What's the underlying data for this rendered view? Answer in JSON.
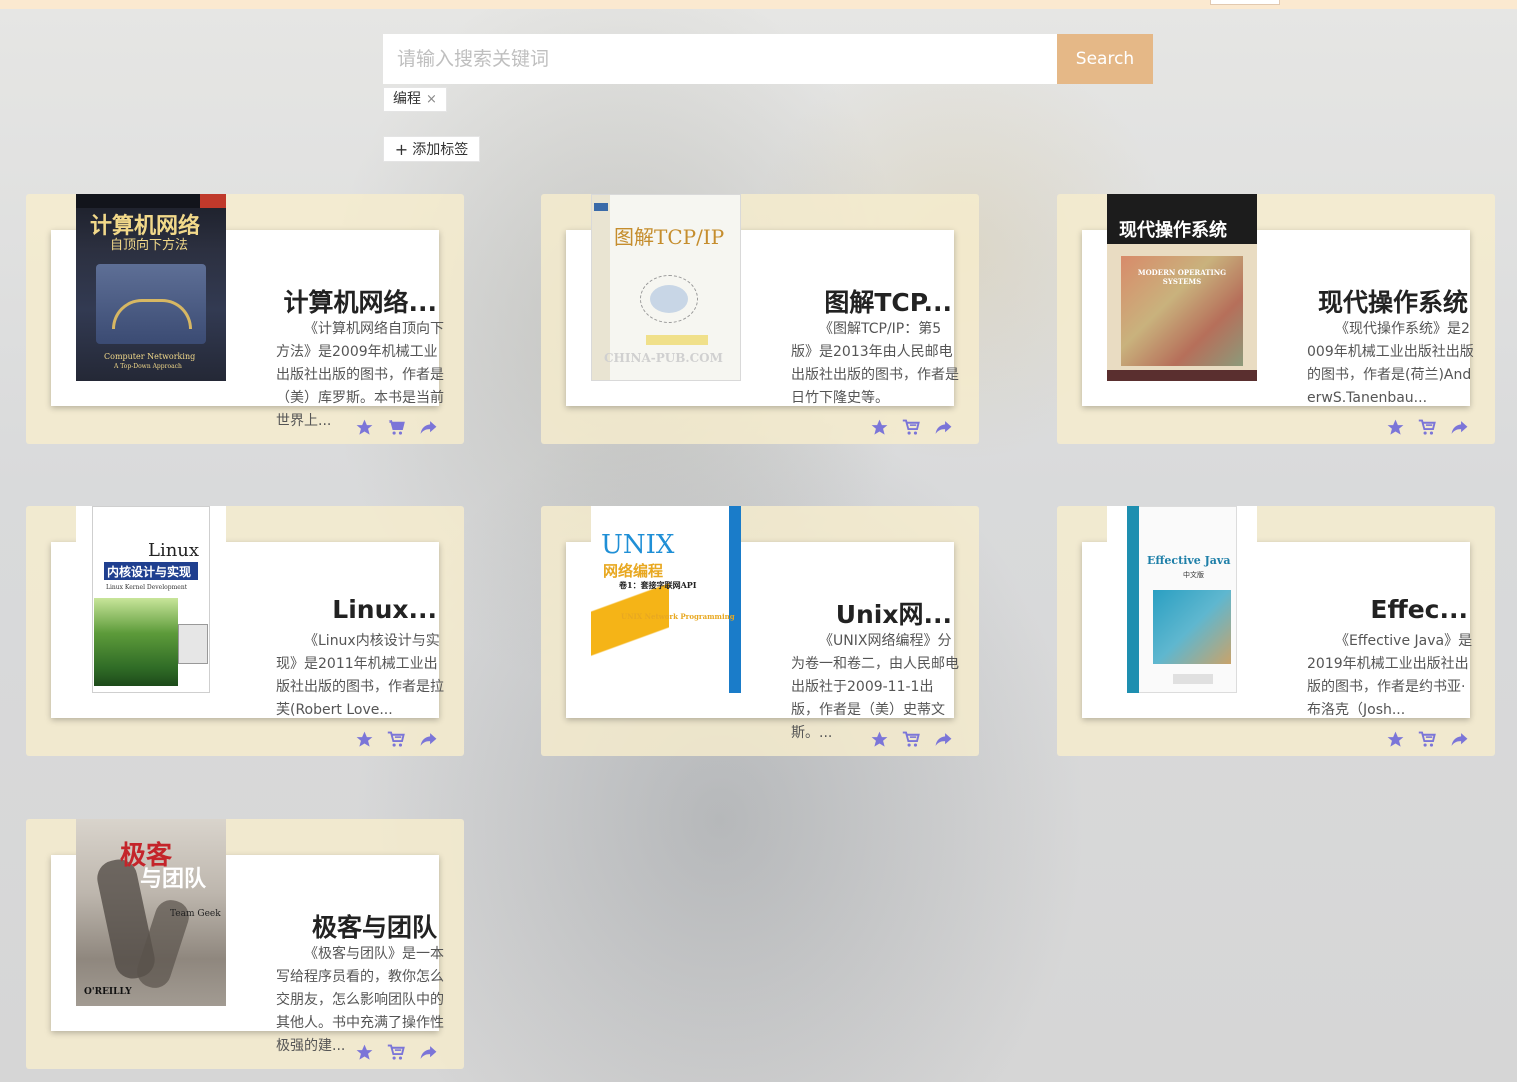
{
  "search": {
    "placeholder": "请输入搜索关键词",
    "button_label": "Search"
  },
  "tags": [
    {
      "label": "编程",
      "close_glyph": "×"
    }
  ],
  "add_tag_label": "添加标签",
  "add_tag_glyph": "+",
  "books": [
    {
      "title": "计算机网络...",
      "description": "《计算机网络自顶向下方法》是2009年机械工业出版社出版的图书，作者是（美）库罗斯。本书是当前世界上...",
      "cover": {
        "main": "计算机网络",
        "sub": "自顶向下方法",
        "en": "Computer Networking",
        "en_sub": "A Top-Down Approach"
      }
    },
    {
      "title": "图解TCP...",
      "description": "《图解TCP/IP：第5版》是2013年由人民邮电出版社出版的图书，作者是日竹下隆史等。",
      "cover": {
        "main": "图解TCP/IP",
        "sub": "",
        "en": "CHINA-PUB.COM",
        "en_sub": ""
      }
    },
    {
      "title": "现代操作系统",
      "description": "《现代操作系统》是2009年机械工业出版社出版的图书，作者是(荷兰)AnderwS.Tanenbau...",
      "cover": {
        "main": "现代操作系统",
        "sub": "",
        "en": "MODERN OPERATING SYSTEMS",
        "en_sub": ""
      }
    },
    {
      "title": "Linux...",
      "description": "《Linux内核设计与实现》是2011年机械工业出版社出版的图书，作者是拉芙(Robert Love...",
      "cover": {
        "main": "Linux",
        "sub": "内核设计与实现",
        "en": "Linux Kernel Development",
        "en_sub": ""
      }
    },
    {
      "title": "Unix网...",
      "description": "《UNIX网络编程》分为卷一和卷二，由人民邮电出版社于2009-11-1出版，作者是（美）史蒂文斯。...",
      "cover": {
        "main": "UNIX",
        "sub": "网络编程",
        "en": "UNIX Network Programming",
        "en_sub": "卷1：套接字联网API"
      }
    },
    {
      "title": "Effec...",
      "description": "《Effective Java》是2019年机械工业出版社出版的图书，作者是约书亚·布洛克（Josh...",
      "cover": {
        "main": "Effective Java",
        "sub": "中文版",
        "en": "",
        "en_sub": ""
      }
    },
    {
      "title": "极客与团队",
      "description": "《极客与团队》是一本写给程序员看的，教你怎么交朋友，怎么影响团队中的其他人。书中充满了操作性极强的建...",
      "cover": {
        "main": "极客",
        "sub": "与团队",
        "en": "Team Geek",
        "en_sub": "O'REILLY"
      }
    }
  ],
  "action_icons": [
    "star-icon",
    "cart-icon",
    "share-icon"
  ],
  "colors": {
    "accent": "#e5b887",
    "card_bg": "#f7edcd",
    "icon": "#7b75d8",
    "topbar": "#fbe9d0"
  }
}
